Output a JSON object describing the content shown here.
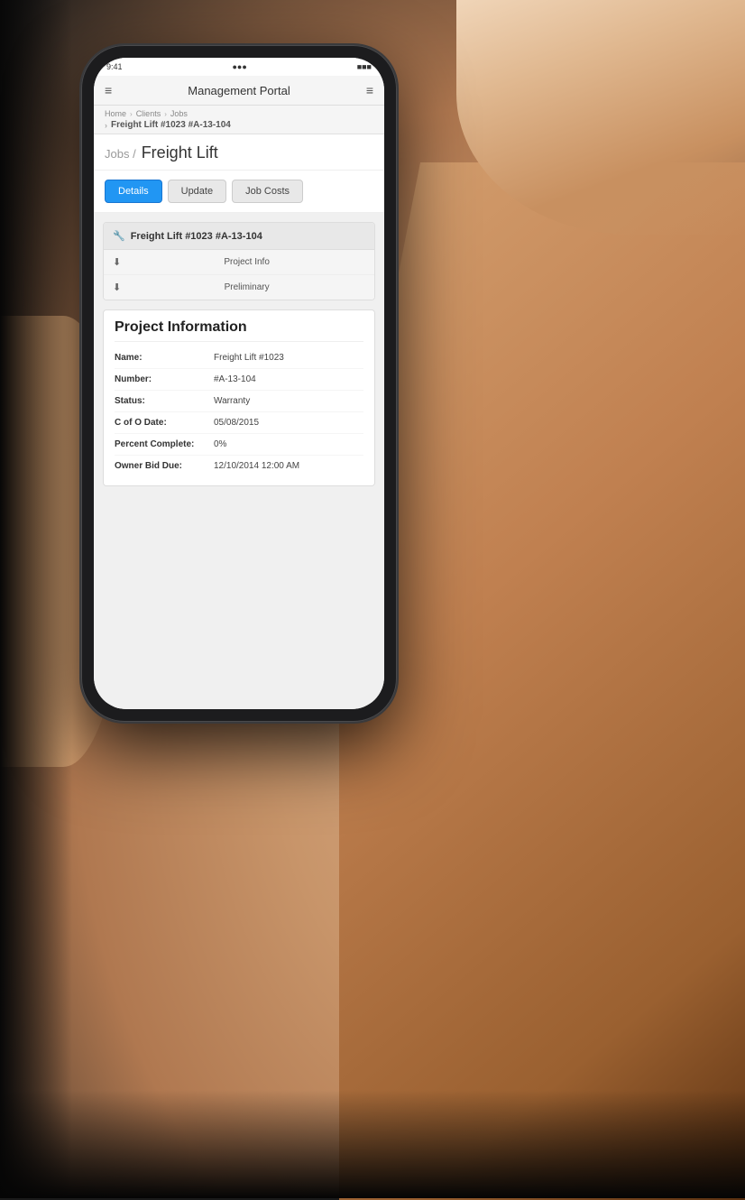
{
  "page": {
    "background_color": "#1a1a1a"
  },
  "header": {
    "title": "Management Portal",
    "menu_icon": "≡",
    "right_icon": "≡"
  },
  "breadcrumb": {
    "items": [
      "Home",
      "Clients",
      "Jobs"
    ],
    "current": "Freight Lift #1023 #A-13-104",
    "separators": [
      "›",
      "›"
    ]
  },
  "page_title": {
    "prefix": "Jobs /",
    "main": "Freight Lift"
  },
  "buttons": {
    "details": "Details",
    "update": "Update",
    "job_costs": "Job Costs"
  },
  "job_card": {
    "title": "Freight Lift #1023 #A-13-104",
    "documents": [
      {
        "label": "Project Info",
        "icon": "⬇"
      },
      {
        "label": "Preliminary",
        "icon": "⬇"
      }
    ]
  },
  "project_information": {
    "section_title": "Project Information",
    "fields": [
      {
        "label": "Name:",
        "value": "Freight Lift #1023"
      },
      {
        "label": "Number:",
        "value": "#A-13-104"
      },
      {
        "label": "Status:",
        "value": "Warranty"
      },
      {
        "label": "C of O Date:",
        "value": "05/08/2015"
      },
      {
        "label": "Percent Complete:",
        "value": "0%"
      },
      {
        "label": "Owner Bid Due:",
        "value": "12/10/2014 12:00 AM"
      }
    ]
  },
  "status_bar": {
    "time": "9:41",
    "signal": "●●●",
    "battery": "■■■"
  },
  "colors": {
    "active_button": "#2196F3",
    "button_inactive": "#e8e8e8",
    "header_bg": "#f5f5f5"
  }
}
